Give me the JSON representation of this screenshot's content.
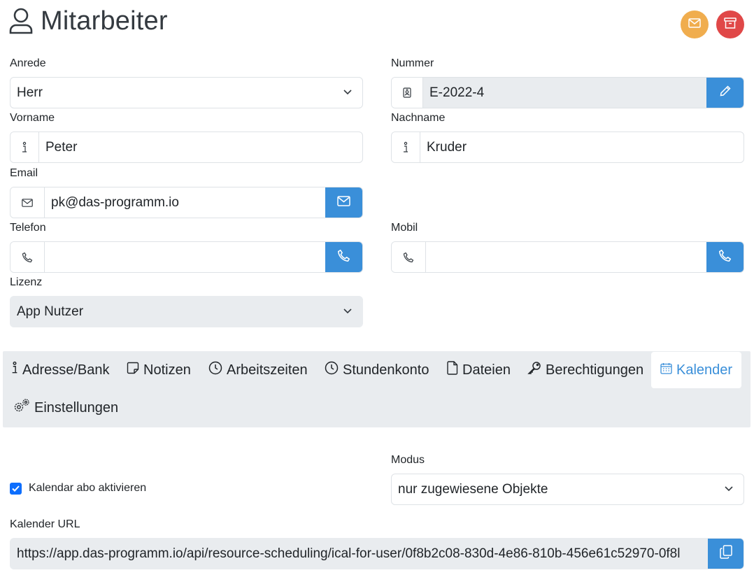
{
  "header": {
    "title": "Mitarbeiter",
    "title_icon": "user-icon",
    "mail_button_icon": "envelope-icon",
    "archive_button_icon": "archive-icon"
  },
  "form": {
    "anrede": {
      "label": "Anrede",
      "value": "Herr"
    },
    "nummer": {
      "label": "Nummer",
      "value": "E-2022-4",
      "icon": "id-badge-icon",
      "button_icon": "pencil-icon"
    },
    "vorname": {
      "label": "Vorname",
      "value": "Peter",
      "icon": "info-icon"
    },
    "nachname": {
      "label": "Nachname",
      "value": "Kruder",
      "icon": "info-icon"
    },
    "email": {
      "label": "Email",
      "value": "pk@das-programm.io",
      "icon": "envelope-icon",
      "button_icon": "envelope-icon"
    },
    "telefon": {
      "label": "Telefon",
      "value": "",
      "icon": "phone-icon",
      "button_icon": "phone-icon"
    },
    "mobil": {
      "label": "Mobil",
      "value": "",
      "icon": "phone-icon",
      "button_icon": "phone-icon"
    },
    "lizenz": {
      "label": "Lizenz",
      "value": "App Nutzer"
    }
  },
  "tabs": [
    {
      "label": "Adresse/Bank",
      "icon": "info-icon",
      "active": false
    },
    {
      "label": "Notizen",
      "icon": "note-icon",
      "active": false
    },
    {
      "label": "Arbeitszeiten",
      "icon": "clock-icon",
      "active": false
    },
    {
      "label": "Stundenkonto",
      "icon": "clock-icon",
      "active": false
    },
    {
      "label": "Dateien",
      "icon": "file-icon",
      "active": false
    },
    {
      "label": "Berechtigungen",
      "icon": "key-icon",
      "active": false
    },
    {
      "label": "Kalender",
      "icon": "calendar-icon",
      "active": true
    },
    {
      "label": "Einstellungen",
      "icon": "gears-icon",
      "active": false
    }
  ],
  "kalender": {
    "abo_checkbox_label": "Kalendar abo aktivieren",
    "abo_checked": true,
    "modus": {
      "label": "Modus",
      "value": "nur zugewiesene Objekte"
    },
    "url": {
      "label": "Kalender URL",
      "value": "https://app.das-programm.io/api/resource-scheduling/ical-for-user/0f8b2c08-830d-4e86-810b-456e61c52970-0f8l",
      "button_icon": "copy-icon"
    }
  },
  "colors": {
    "accent": "#3a8fd9",
    "orange": "#f0ad4e",
    "red": "#e04848",
    "tabbar_bg": "#e9ecef",
    "disabled_bg": "#e9ecef"
  }
}
